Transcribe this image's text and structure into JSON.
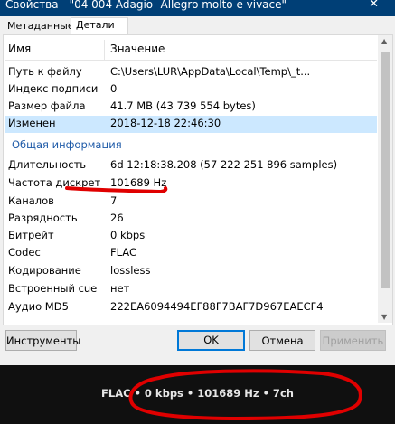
{
  "window": {
    "title": "Свойства - \"04 004 Adagio- Allegro molto e vivace\"",
    "close_glyph": "✕"
  },
  "tabs": [
    {
      "label": "Метаданные",
      "active": false
    },
    {
      "label": "Детали",
      "active": true
    }
  ],
  "columns": {
    "property": "Имя",
    "value": "Значение"
  },
  "rows_file": [
    {
      "property": "Путь к файлу",
      "value": "C:\\Users\\LUR\\AppData\\Local\\Temp\\_t..."
    },
    {
      "property": "Индекс подписи",
      "value": "0"
    },
    {
      "property": "Размер файла",
      "value": "41.7 MB (43 739 554 bytes)"
    },
    {
      "property": "Изменен",
      "value": "2018-12-18 22:46:30",
      "selected": true
    }
  ],
  "group": {
    "label": "Общая информация"
  },
  "rows_general": [
    {
      "property": "Длительность",
      "value": "6d 12:18:38.208 (57 222 251 896 samples)"
    },
    {
      "property": "Частота дискрет",
      "value": "101689 Hz"
    },
    {
      "property": "Каналов",
      "value": "7"
    },
    {
      "property": "Разрядность",
      "value": "26"
    },
    {
      "property": "Битрейт",
      "value": "0 kbps"
    },
    {
      "property": "Codec",
      "value": "FLAC"
    },
    {
      "property": "Кодирование",
      "value": "lossless"
    },
    {
      "property": "Встроенный cue",
      "value": "нет"
    },
    {
      "property": "Аудио MD5",
      "value": "222EA6094494EF88F7BAF7D967EAECF4"
    }
  ],
  "buttons": {
    "tools": "Инструменты",
    "ok": "OK",
    "cancel": "Отмена",
    "apply": "Применить"
  },
  "status": {
    "text": "FLAC • 0 kbps • 101689 Hz • 7ch"
  },
  "colors": {
    "titlebar": "#003f76",
    "selected_row": "#cce8ff",
    "group_label": "#1e5aa8",
    "annotation_red": "#e00000",
    "status_bg": "#101010"
  }
}
